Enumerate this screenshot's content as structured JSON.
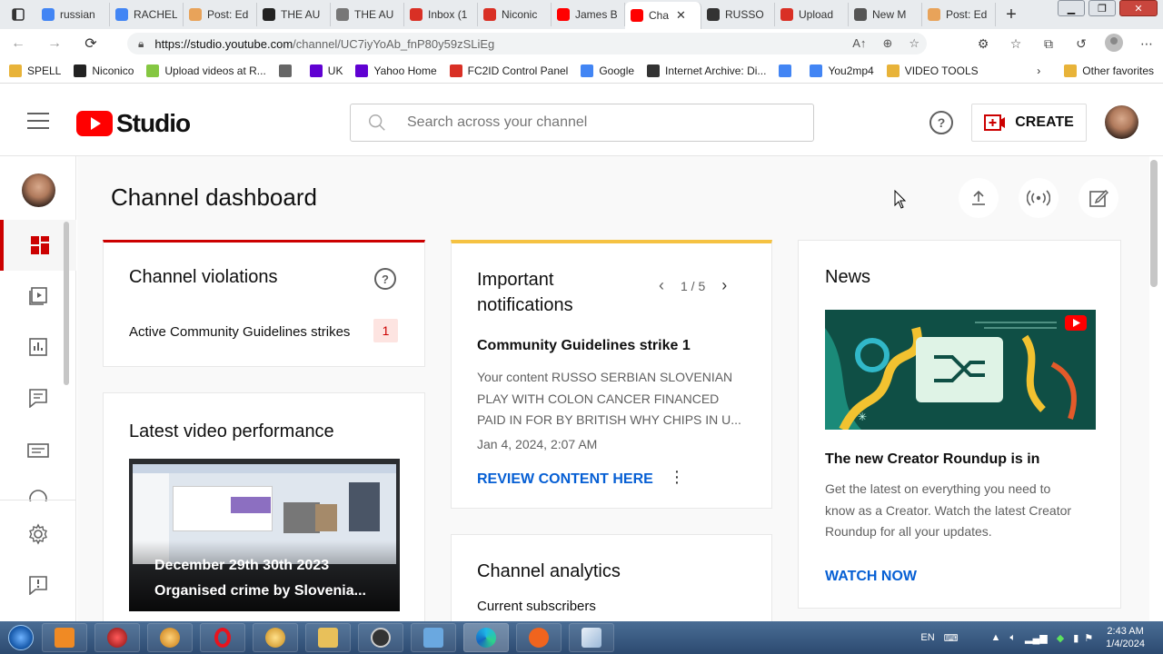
{
  "browser": {
    "tabs": [
      {
        "label": "russian",
        "icon": "google-icon",
        "color": "#4285f4"
      },
      {
        "label": "RACHEL",
        "icon": "google-icon",
        "color": "#4285f4"
      },
      {
        "label": "Post: Ed",
        "icon": "page-icon",
        "color": "#e8a35a"
      },
      {
        "label": "THE AU",
        "icon": "horse-icon",
        "color": "#222222"
      },
      {
        "label": "THE AU",
        "icon": "horse-icon",
        "color": "#777777"
      },
      {
        "label": "Inbox (1",
        "icon": "gmail-icon",
        "color": "#d93025"
      },
      {
        "label": "Niconic",
        "icon": "gmail-icon",
        "color": "#d93025"
      },
      {
        "label": "James B",
        "icon": "youtube-icon",
        "color": "#ff0000"
      },
      {
        "label": "Cha",
        "icon": "youtube-studio-icon",
        "color": "#ff0000",
        "active": true
      },
      {
        "label": "RUSSO",
        "icon": "archive-icon",
        "color": "#333333"
      },
      {
        "label": "Upload",
        "icon": "fc2-icon",
        "color": "#d93025"
      },
      {
        "label": "New M",
        "icon": "mail-icon",
        "color": "#555555"
      },
      {
        "label": "Post: Ed",
        "icon": "page-icon",
        "color": "#e8a35a"
      }
    ],
    "url_host": "https://studio.youtube.com",
    "url_path": "/channel/UC7iyYoAb_fnP80y59zSLiEg",
    "bookmarks": [
      {
        "label": "SPELL",
        "icon": "folder-icon",
        "color": "#e8b339"
      },
      {
        "label": "Niconico",
        "icon": "niconico-icon",
        "color": "#222222"
      },
      {
        "label": "Upload videos at R...",
        "icon": "rumble-icon",
        "color": "#85c742"
      },
      {
        "label": "",
        "icon": "page-icon",
        "color": "#666666"
      },
      {
        "label": "UK",
        "icon": "yahoo-icon",
        "color": "#6001d2"
      },
      {
        "label": "Yahoo Home",
        "icon": "yahoo-icon",
        "color": "#6001d2"
      },
      {
        "label": "FC2ID Control Panel",
        "icon": "fc2-icon",
        "color": "#d93025"
      },
      {
        "label": "Google",
        "icon": "google-icon",
        "color": "#4285f4"
      },
      {
        "label": "Internet Archive: Di...",
        "icon": "archive-icon",
        "color": "#333333"
      },
      {
        "label": "",
        "icon": "translate-icon",
        "color": "#4285f4"
      },
      {
        "label": "You2mp4",
        "icon": "google-icon",
        "color": "#4285f4"
      },
      {
        "label": "VIDEO TOOLS",
        "icon": "folder-icon",
        "color": "#e8b339"
      }
    ],
    "other_favorites": "Other favorites"
  },
  "header": {
    "logo_text": "Studio",
    "search_placeholder": "Search across your channel",
    "create_label": "CREATE"
  },
  "dashboard": {
    "title": "Channel dashboard",
    "violations": {
      "title": "Channel violations",
      "label": "Active Community Guidelines strikes",
      "count": "1"
    },
    "notifications": {
      "title_line1": "Important",
      "title_line2": "notifications",
      "pager": "1 / 5",
      "strike_title": "Community Guidelines strike 1",
      "body_l1": "Your content RUSSO SERBIAN SLOVENIAN",
      "body_l2": "PLAY WITH COLON CANCER FINANCED",
      "body_l3": "PAID IN FOR BY BRITISH WHY CHIPS IN U...",
      "date": "Jan 4, 2024, 2:07 AM",
      "link": "REVIEW CONTENT HERE"
    },
    "news": {
      "title": "News",
      "headline": "The new Creator Roundup is in",
      "body_l1": "Get the latest on everything you need to",
      "body_l2": "know as a Creator. Watch the latest Creator",
      "body_l3": "Roundup for all your updates.",
      "link": "WATCH NOW"
    },
    "latest_video": {
      "title": "Latest video performance",
      "caption_l1": "December 29th 30th 2023",
      "caption_l2": "Organised crime by Slovenia..."
    },
    "analytics": {
      "title": "Channel analytics",
      "subscribers_label": "Current subscribers"
    }
  },
  "taskbar": {
    "lang": "EN",
    "time": "2:43 AM",
    "date": "1/4/2024"
  },
  "colors": {
    "brand_red": "#ff0000",
    "accent_red": "#cc0000",
    "notif_yellow": "#f5c242",
    "link_blue": "#065fd4"
  }
}
